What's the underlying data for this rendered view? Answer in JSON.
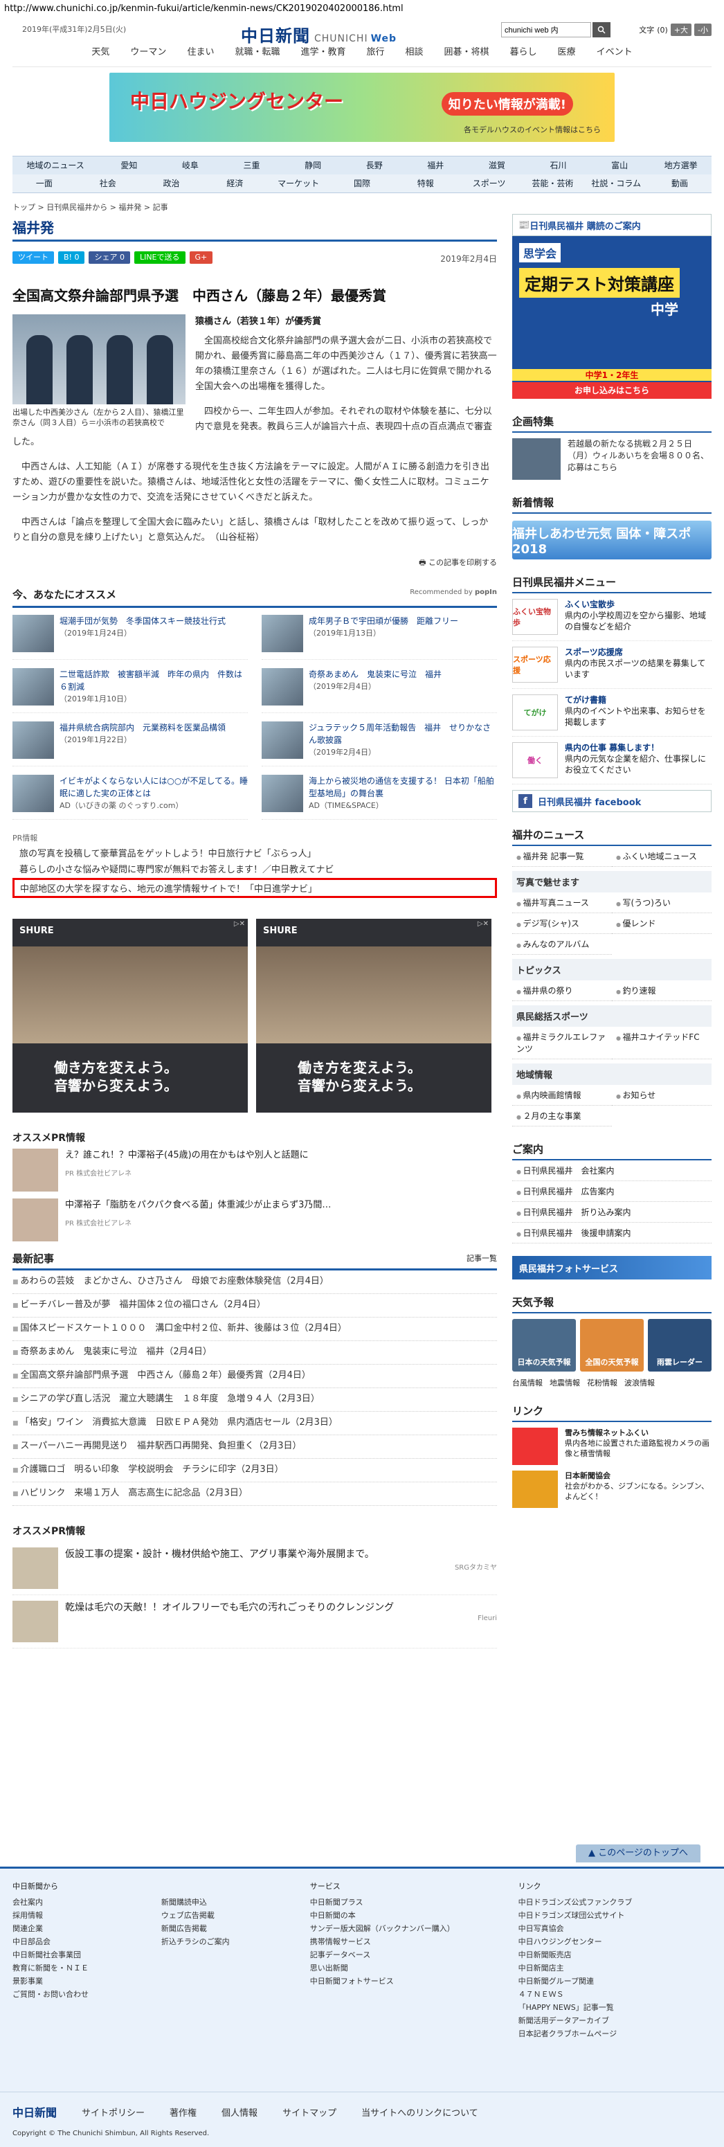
{
  "url": "http://www.chunichi.co.jp/kenmin-fukui/article/kenmin-news/CK2019020402000186.html",
  "header": {
    "date": "2019年(平成31年)2月5日(火)",
    "logo": "中日新聞",
    "logo_sub": "CHUNICHI",
    "logo_web": "Web",
    "search_value": "chunichi web 内",
    "font_label": "文字",
    "font_reset": "(0)",
    "font_up": "+大",
    "font_down": "-小",
    "nav": [
      "天気",
      "ウーマン",
      "住まい",
      "就職・転職",
      "進学・教育",
      "旅行",
      "相談",
      "囲碁・将棋",
      "暮らし",
      "医療",
      "イベント"
    ]
  },
  "banner": {
    "title": "中日ハウジングセンター",
    "cta": "知りたい情報が満載!",
    "sub": "各モデルハウスのイベント情報はこちら"
  },
  "region_nav": [
    "地域のニュース",
    "愛知",
    "岐阜",
    "三重",
    "静岡",
    "長野",
    "福井",
    "滋賀",
    "石川",
    "富山",
    "地方選挙"
  ],
  "section_nav": [
    "一面",
    "社会",
    "政治",
    "経済",
    "マーケット",
    "国際",
    "特報",
    "スポーツ",
    "芸能・芸術",
    "社説・コラム",
    "動画"
  ],
  "breadcrumb": "トップ > 日刊県民福井から > 福井発 > 記事",
  "section_title": "福井発",
  "share": {
    "tweet": "ツイート",
    "hb": "B! 0",
    "fb": "シェア 0",
    "line": "LINEで送る",
    "gplus": "G+",
    "date": "2019年2月4日"
  },
  "article": {
    "headline": "全国高文祭弁論部門県予選　中西さん（藤島２年）最優秀賞",
    "caption": "出場した中西美沙さん（左から２人目）、猿橋江里奈さん（同３人目）ら＝小浜市の若狭高校で",
    "subhead": "猿橋さん（若狭１年）が優秀賞",
    "p1": "全国高校総合文化祭弁論部門の県予選大会が二日、小浜市の若狭高校で開かれ、最優秀賞に藤島高二年の中西美沙さん（１７）、優秀賞に若狭高一年の猿橋江里奈さん（１６）が選ばれた。二人は七月に佐賀県で開かれる全国大会への出場権を獲得した。",
    "p2": "四校から一、二年生四人が参加。それぞれの取材や体験を基に、七分以内で意見を発表。教員ら三人が論旨六十点、表現四十点の百点満点で審査した。",
    "p3": "中西さんは、人工知能（ＡＩ）が席巻する現代を生き抜く方法論をテーマに設定。人間がＡＩに勝る創造力を引き出すため、遊びの重要性を説いた。猿橋さんは、地域活性化と女性の活躍をテーマに、働く女性二人に取材。コミュニケーション力が豊かな女性の力で、交流を活発にさせていくべきだと訴えた。",
    "p4": "中西さんは「論点を整理して全国大会に臨みたい」と話し、猿橋さんは「取材したことを改めて振り返って、しっかりと自分の意見を練り上げたい」と意気込んだ。　（山谷柾裕）",
    "print": "この記事を印刷する"
  },
  "recommend": {
    "title": "今、あなたにオススメ",
    "by": "Recommended by",
    "brand": "popIn",
    "items": [
      {
        "title": "堀潮手団が気勢　冬季国体スキー競技壮行式",
        "date": "（2019年1月24日）"
      },
      {
        "title": "成年男子Ｂで宇田頑が優勝　距離フリー",
        "date": "（2019年1月13日）"
      },
      {
        "title": "二世電話詐欺　被害額半減　昨年の県内　件数は６割減",
        "date": "（2019年1月10日）"
      },
      {
        "title": "奇祭あまめん　鬼装束に号泣　福井",
        "date": "（2019年2月4日）"
      },
      {
        "title": "福井県統合病院部内　元業務料を医業品構領",
        "date": "（2019年1月22日）"
      },
      {
        "title": "ジュラテック５周年活動報告　福井　せりかなさん歌披露",
        "date": "（2019年2月4日）"
      },
      {
        "title": "イビキがよくならない人には○○が不足してる。睡眠に適した実の正体とは",
        "date": "AD（いびきの薬 のぐっすり.com）"
      },
      {
        "title": "海上から被災地の通信を支援する！ 日本初「船舶型基地局」の舞台裏",
        "date": "AD（TIME&SPACE）"
      }
    ]
  },
  "pr": {
    "label": "PR情報",
    "links": [
      "旅の写真を投稿して豪華賞品をゲットしよう！中日旅行ナビ「ぶらっ人」",
      "暮らしの小さな悩みや疑問に専門家が無料でお答えします！／中日教えてナビ",
      "中部地区の大学を探すなら、地元の進学情報サイトで！「中日進学ナビ」"
    ]
  },
  "ads": {
    "brand": "SHURE",
    "slogan1": "働き方を変えよう。",
    "slogan2": "音響から変えよう。"
  },
  "osusume_pr": {
    "title": "オススメPR情報",
    "items": [
      {
        "title": "え？誰これ！？中澤裕子(45歳)の用在かもはや別人と話題に",
        "src": "PR 株式会社ビアレネ"
      },
      {
        "title": "中澤裕子「脂肪をパクパク食べる菌」体重減少が止まらず3乃間…",
        "src": "PR 株式会社ビアレネ"
      }
    ]
  },
  "latest": {
    "title": "最新記事",
    "more": "記事一覧",
    "items": [
      "あわらの芸妓　まどかさん、ひさ乃さん　母娘でお座敷体験発信（2月4日）",
      "ビーチバレー普及が夢　福井国体２位の福口さん（2月4日）",
      "国体スピードスケート１０００　溝口金中村２位、新井、後藤は３位（2月4日）",
      "奇祭あまめん　鬼装束に号泣　福井（2月4日）",
      "全国高文祭弁論部門県予選　中西さん（藤島２年）最優秀賞（2月4日）",
      "シニアの学び直し活況　瀧立大聴講生　１８年度　急増９４人（2月3日）",
      "「格安」ワイン　消費拡大意識　日欧ＥＰＡ発効　県内酒店セール（2月3日）",
      "スーパーハニー再開見送り　福井駅西口再開発、負担重く（2月3日）",
      "介護職ロゴ　明るい印象　学校説明会　チラシに印字（2月3日）",
      "ハピリンク　来場１万人　高志高生に記念品（2月3日）"
    ]
  },
  "osusume_pr2": {
    "title": "オススメPR情報",
    "items": [
      {
        "title": "仮設工事の提案・設計・機材供給や施工、アグリ事業や海外展開まで。",
        "src": "SRGタカミヤ"
      },
      {
        "title": "乾燥は毛穴の天敵！！オイルフリーでも毛穴の汚れごっそりのクレンジング",
        "src": "Fleuri"
      }
    ]
  },
  "side": {
    "kenmin_bar": "日刊県民福井 購読のご案内",
    "ad": {
      "brand": "思学会",
      "title": "定期テスト対策講座",
      "main": "中学",
      "tag": "中学1・2年生",
      "cta": "お申し込みはこちら"
    },
    "kikaku_title": "企画特集",
    "kikaku_text": "若越最の新たなる挑戦２月２５日（月）ウィルあいちを会場８００名、応募はこちら",
    "shincho_title": "新着情報",
    "shincho_bnr": "福井しあわせ元気 国体・障スポ 2018",
    "menu_title": "日刊県民福井メニュー",
    "menu": [
      {
        "ic": "ふくい宝物歩",
        "title": "ふくい宝散歩",
        "text": "県内の小学校周辺を空から撮影、地域の自慢などを紹介"
      },
      {
        "ic": "スポーツ応援",
        "title": "スポーツ応援席",
        "text": "県内の市民スポーツの結果を募集しています"
      },
      {
        "ic": "てがけ",
        "title": "てがけ書籍",
        "text": "県内のイベントや出来事、お知らせを掲載します"
      },
      {
        "ic": "働く",
        "title": "県内の仕事 募集します！",
        "text": "県内の元気な企業を紹介、仕事探しにお役立てください"
      }
    ],
    "fb": "日刊県民福井 facebook",
    "fukui_news_title": "福井のニュース",
    "news_links": [
      "福井発 記事一覧",
      "ふくい地域ニュース"
    ],
    "photo_title": "写真で魅せます",
    "photo_links": [
      "福井写真ニュース",
      "写(うつ)ろい",
      "デジ写(シャ)ス",
      "優レンド",
      "みんなのアルバム"
    ],
    "topics_title": "トピックス",
    "topics_links": [
      "福井県の祭り",
      "釣り速報"
    ],
    "sports_title": "県民総括スポーツ",
    "sports_links": [
      "福井ミラクルエレファンツ",
      "福井ユナイテッドFC"
    ],
    "local_title": "地域情報",
    "local_links": [
      "県内映画館情報",
      "お知らせ",
      "２月の主な事業"
    ],
    "guide_title": "ご案内",
    "guide_links": [
      "日刊県民福井　会社案内",
      "日刊県民福井　広告案内",
      "日刊県民福井　折り込み案内",
      "日刊県民福井　後援申請案内"
    ],
    "photosvc": "県民福井フォトサービス",
    "weather_title": "天気予報",
    "weather_tiles": [
      "日本の天気予報",
      "全国の天気予報",
      "雨雲レーダー"
    ],
    "weather_links": [
      "台風情報",
      "地震情報",
      "花粉情報",
      "波浪情報"
    ],
    "link_title": "リンク",
    "links": [
      {
        "title": "雪みち情報ネットふくい",
        "text": "県内各地に設置された道路監視カメラの画像と積雪情報"
      },
      {
        "title": "日本新聞協会",
        "text": "社会がわかる、ジブンになる。シンブン、よんどく！"
      }
    ]
  },
  "footer": {
    "toplink": "このページのトップへ",
    "col1_title": "中日新聞から",
    "col1": [
      "会社案内",
      "採用情報",
      "関連企業",
      "中日部品会",
      "中日新聞社会事業団",
      "教育に新聞を・ＮＩＥ",
      "景影事業",
      "ご質問・お問い合わせ"
    ],
    "col1b": [
      "新聞購読申込",
      "ウェブ広告掲載",
      "新聞広告掲載",
      "折込チラシのご案内"
    ],
    "col2_title": "サービス",
    "col2": [
      "中日新聞プラス",
      "中日新聞の本",
      "サンデー版大図解（バックナンバー購入）",
      "携帯情報サービス",
      "記事データベース",
      "思い出新聞",
      "中日新聞フォトサービス"
    ],
    "col3_title": "リンク",
    "col3": [
      "中日ドラゴンズ公式ファンクラブ",
      "中日ドラゴンズ球団公式サイト",
      "中日写真協会",
      "中日ハウジングセンター",
      "中日新聞販売店",
      "中日新聞店主",
      "中日新聞グループ関連",
      "４７ＮＥＷＳ",
      "「HAPPY NEWS」記事一覧",
      "新聞活用データアーカイブ",
      "日本記者クラブホームページ"
    ],
    "bottom": [
      "サイトポリシー",
      "著作権",
      "個人情報",
      "サイトマップ",
      "当サイトへのリンクについて"
    ],
    "logo": "中日新聞",
    "copyright": "Copyright © The Chunichi Shimbun, All Rights Reserved."
  }
}
